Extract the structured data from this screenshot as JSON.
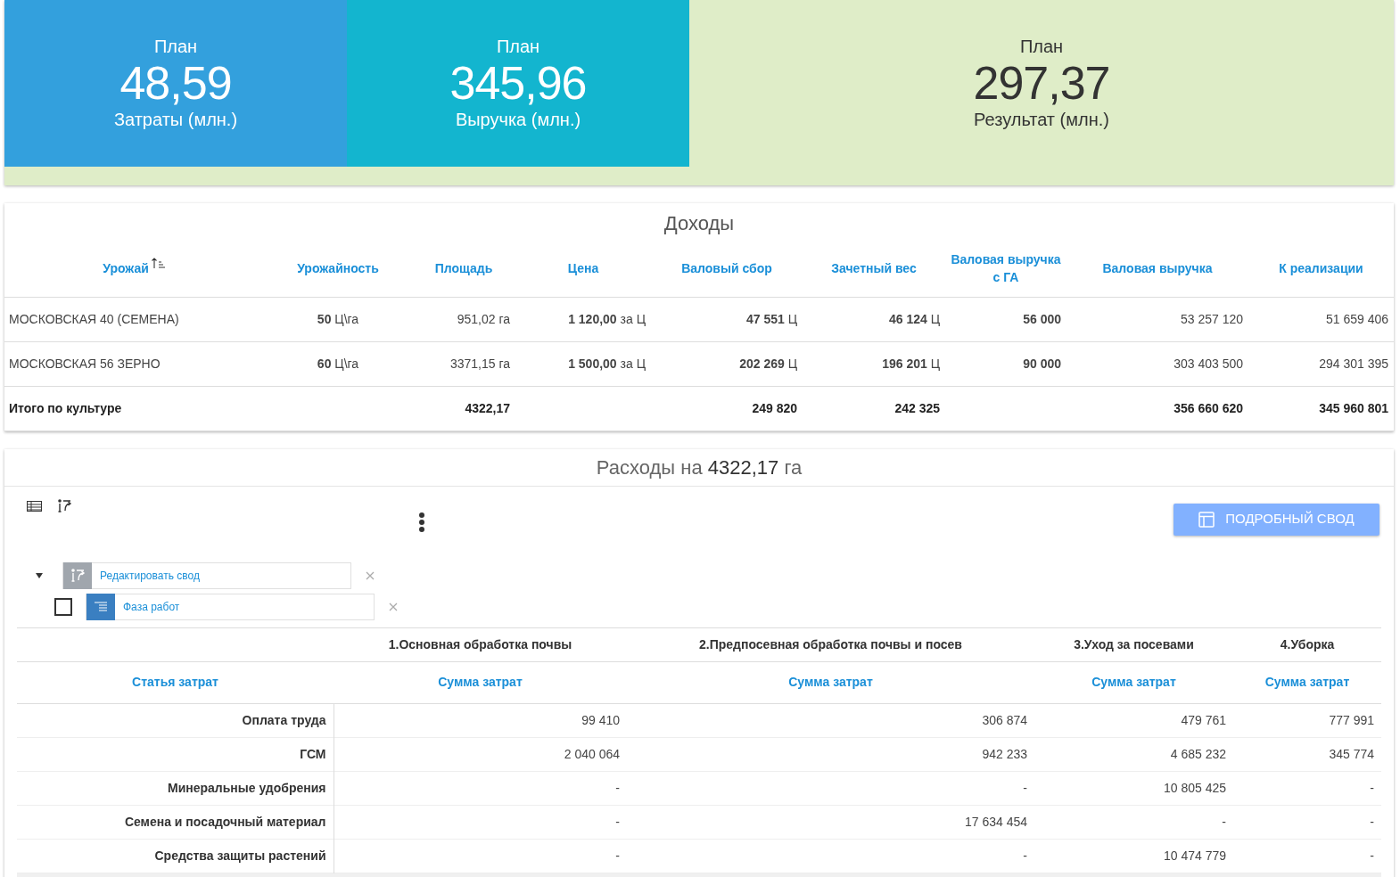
{
  "summary_tiles": [
    {
      "kind": "cost",
      "caption": "План",
      "value": "48,59",
      "label": "Затраты (млн.)"
    },
    {
      "kind": "revenue",
      "caption": "План",
      "value": "345,96",
      "label": "Выручка (млн.)"
    },
    {
      "kind": "result",
      "caption": "План",
      "value": "297,37",
      "label": "Результат (млн.)"
    }
  ],
  "income": {
    "title": "Доходы",
    "columns": [
      {
        "label": "Урожай",
        "sorted": true
      },
      {
        "label": "Урожайность",
        "sorted": false
      },
      {
        "label": "Площадь",
        "sorted": false
      },
      {
        "label": "Цена",
        "sorted": false
      },
      {
        "label": "Валовый сбор",
        "sorted": false
      },
      {
        "label": "Зачетный вес",
        "sorted": false
      },
      {
        "label": "Валовая выручка с ГА",
        "sorted": false
      },
      {
        "label": "Валовая выручка",
        "sorted": false
      },
      {
        "label": "К реализации",
        "sorted": false
      }
    ],
    "rows": [
      {
        "kind": "item",
        "cells": [
          "МОСКОВСКАЯ 40 (СЕМЕНА)",
          "**50** Ц\\га",
          "951,02 га",
          "**1 120,00** за Ц",
          "**47 551** Ц",
          "**46 124** Ц",
          "**56 000**",
          "53 257 120",
          "51 659 406"
        ]
      },
      {
        "kind": "item",
        "cells": [
          "МОСКОВСКАЯ 56 ЗЕРНО",
          "**60** Ц\\га",
          "3371,15 га",
          "**1 500,00** за Ц",
          "**202 269** Ц",
          "**196 201** Ц",
          "**90 000**",
          "303 403 500",
          "294 301 395"
        ]
      },
      {
        "kind": "total",
        "cells": [
          "Итого по культуре",
          "",
          "4322,17",
          "",
          "249 820",
          "242 325",
          "",
          "356 660 620",
          "345 960 801"
        ]
      }
    ]
  },
  "expenses": {
    "title": "Расходы на **4322,17** га",
    "detail_button": "ПОДРОБНЫЙ СВОД",
    "filters": [
      {
        "kind": "group",
        "label": "Редактировать свод",
        "expanded": true
      },
      {
        "kind": "field",
        "label": "Фаза работ",
        "checked": false
      }
    ],
    "pivot": {
      "phases": [
        "1.Основная обработка почвы",
        "2.Предпосевная обработка почвы и посев",
        "3.Уход за посевами",
        "4.Уборка"
      ],
      "row_header": "Статья затрат",
      "measure_headers": [
        "Сумма затрат",
        "Сумма затрат",
        "Сумма затрат",
        "Сумма затрат"
      ],
      "rows": [
        {
          "label": "Оплата труда",
          "values": [
            "99 410",
            "306 874",
            "479 761",
            "777 991"
          ]
        },
        {
          "label": "ГСМ",
          "values": [
            "2 040 064",
            "942 233",
            "4 685 232",
            "345 774"
          ]
        },
        {
          "label": "Минеральные удобрения",
          "values": [
            "-",
            "-",
            "10 805 425",
            "-"
          ]
        },
        {
          "label": "Семена и посадочный материал",
          "values": [
            "-",
            "17 634 454",
            "-",
            "-"
          ]
        },
        {
          "label": "Средства защиты растений",
          "values": [
            "-",
            "-",
            "10 474 779",
            "-"
          ]
        }
      ]
    }
  }
}
